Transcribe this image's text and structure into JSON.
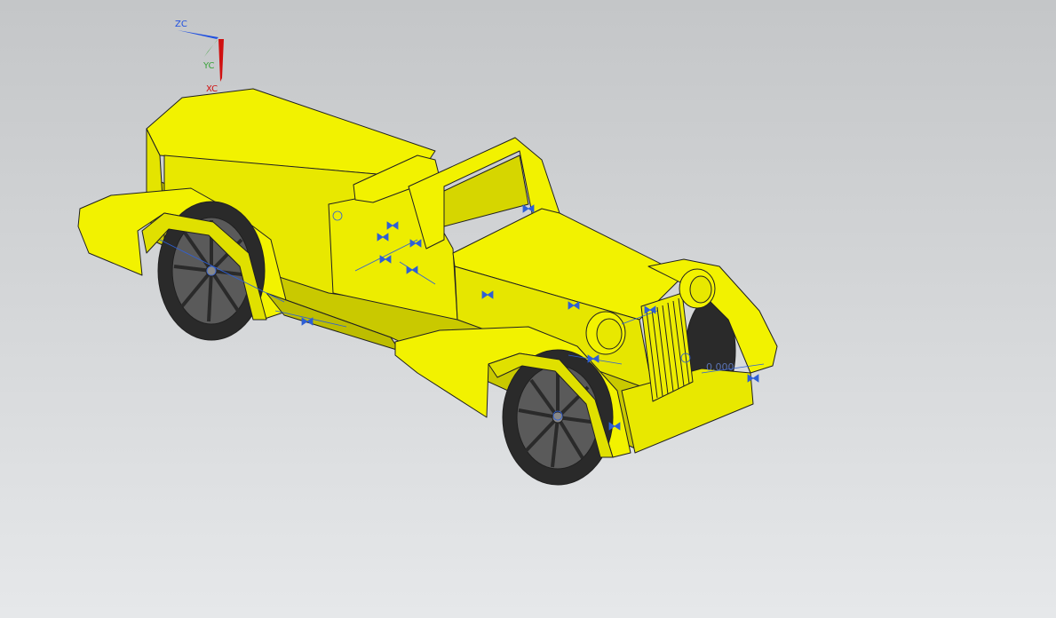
{
  "triad": {
    "z_label": "ZC",
    "y_label": "YC",
    "x_label": "XC",
    "colors": {
      "z": "#2050e0",
      "y": "#3aa23a",
      "x": "#d01010"
    }
  },
  "model": {
    "body_color": "#f2f200",
    "body_shade": "#c9c900",
    "tire_color": "#2a2a2a",
    "spoke_color": "#6a6a6a",
    "edge_color": "#202020",
    "constraint_color": "#2e5fd6",
    "dimension_value": "0.000"
  }
}
